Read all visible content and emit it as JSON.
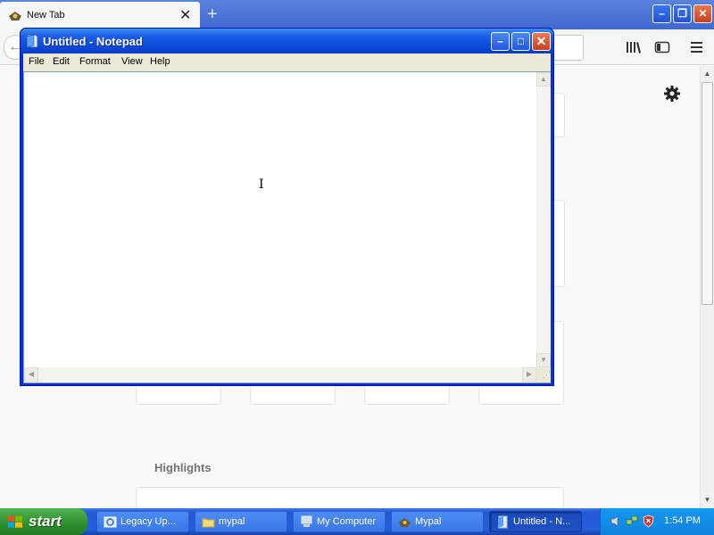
{
  "browser": {
    "tab_title": "New Tab",
    "tab_close_glyph": "✕",
    "new_tab_glyph": "+",
    "window_buttons": {
      "minimize": "–",
      "restore": "❐",
      "close": "✕"
    },
    "back_glyph": "←",
    "highlights_title": "Highlights"
  },
  "notepad": {
    "title": "Untitled - Notepad",
    "menu": [
      "File",
      "Edit",
      "Format",
      "View",
      "Help"
    ],
    "text": "",
    "window_buttons": {
      "minimize": "–",
      "maximize": "□",
      "close": "✕"
    }
  },
  "taskbar": {
    "start_label": "start",
    "tasks": [
      {
        "label": "Legacy Up...",
        "icon": "update-icon"
      },
      {
        "label": "mypal",
        "icon": "folder-icon"
      },
      {
        "label": "My Computer",
        "icon": "computer-icon"
      },
      {
        "label": "Mypal",
        "icon": "mypal-browser-icon"
      },
      {
        "label": "Untitled - N...",
        "icon": "notepad-icon"
      }
    ],
    "clock": "1:54 PM"
  },
  "colors": {
    "xp_blue": "#245edb",
    "start_green": "#2d8f2d",
    "tray_blue": "#0f84e0",
    "close_red": "#c8411b"
  }
}
